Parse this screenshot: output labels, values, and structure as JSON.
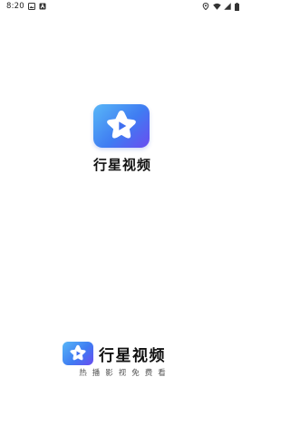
{
  "status_bar": {
    "time": "8:20",
    "left_icons": [
      "image-icon",
      "a-box-icon"
    ],
    "right_icons": [
      "location-icon",
      "wifi-icon",
      "signal-icon",
      "battery-icon"
    ]
  },
  "app": {
    "name": "行星视频",
    "icon": "star-play-icon",
    "brand_colors": [
      "#59b7f7",
      "#3f7cf2",
      "#6a4cf0"
    ]
  },
  "footer": {
    "name": "行星视频",
    "slogan": "热播影视免费看",
    "icon": "star-play-icon"
  }
}
